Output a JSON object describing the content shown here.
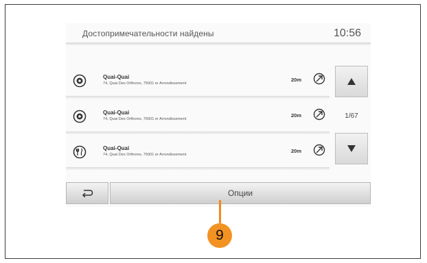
{
  "header": {
    "title": "Достопримечательности найдены",
    "clock": "10:56"
  },
  "results": [
    {
      "name": "Quai-Quai",
      "address": "74, Quai Des Orfèvres, 75001 er Arrondissement",
      "distance": "20m",
      "icon": "poi-marker-icon"
    },
    {
      "name": "Quai-Quai",
      "address": "74, Quai Des Orfèvres, 75001 er Arrondissement",
      "distance": "20m",
      "icon": "poi-marker-icon"
    },
    {
      "name": "Quai-Quai",
      "address": "74, Quai Des Orfèvres, 75001 er Arrondissement",
      "distance": "20m",
      "icon": "poi-restaurant-icon"
    }
  ],
  "pagination": {
    "indicator": "1/67"
  },
  "footer": {
    "options_label": "Опции"
  },
  "callout": {
    "number": "9",
    "color": "#f29222"
  }
}
